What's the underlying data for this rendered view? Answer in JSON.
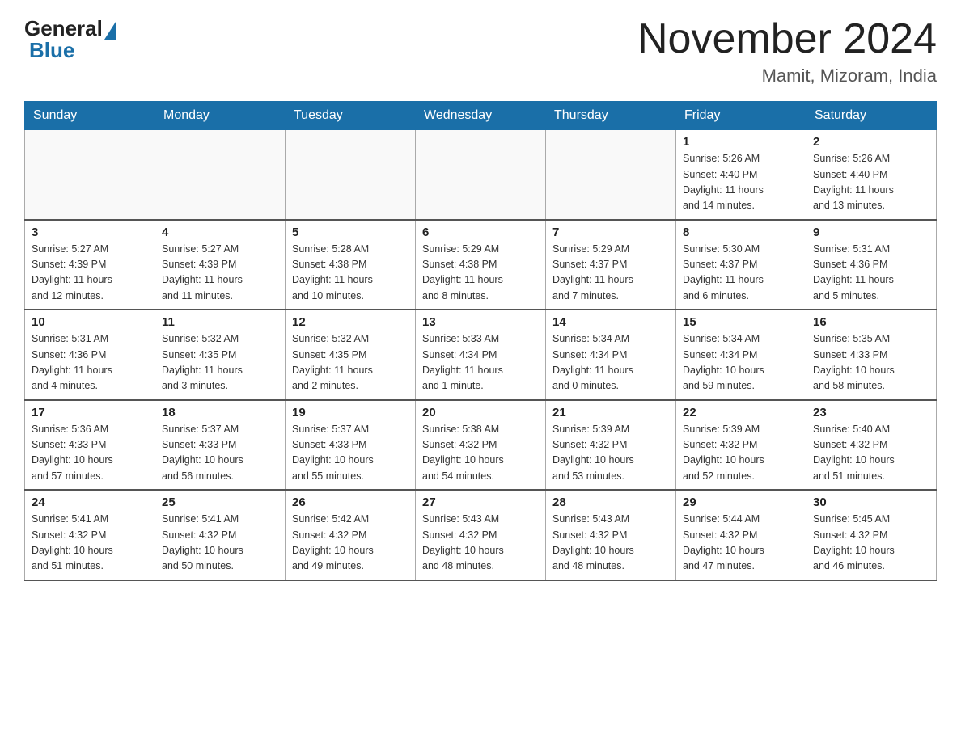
{
  "logo": {
    "general": "General",
    "blue": "Blue"
  },
  "header": {
    "month": "November 2024",
    "location": "Mamit, Mizoram, India"
  },
  "weekdays": [
    "Sunday",
    "Monday",
    "Tuesday",
    "Wednesday",
    "Thursday",
    "Friday",
    "Saturday"
  ],
  "weeks": [
    [
      {
        "day": "",
        "info": ""
      },
      {
        "day": "",
        "info": ""
      },
      {
        "day": "",
        "info": ""
      },
      {
        "day": "",
        "info": ""
      },
      {
        "day": "",
        "info": ""
      },
      {
        "day": "1",
        "info": "Sunrise: 5:26 AM\nSunset: 4:40 PM\nDaylight: 11 hours\nand 14 minutes."
      },
      {
        "day": "2",
        "info": "Sunrise: 5:26 AM\nSunset: 4:40 PM\nDaylight: 11 hours\nand 13 minutes."
      }
    ],
    [
      {
        "day": "3",
        "info": "Sunrise: 5:27 AM\nSunset: 4:39 PM\nDaylight: 11 hours\nand 12 minutes."
      },
      {
        "day": "4",
        "info": "Sunrise: 5:27 AM\nSunset: 4:39 PM\nDaylight: 11 hours\nand 11 minutes."
      },
      {
        "day": "5",
        "info": "Sunrise: 5:28 AM\nSunset: 4:38 PM\nDaylight: 11 hours\nand 10 minutes."
      },
      {
        "day": "6",
        "info": "Sunrise: 5:29 AM\nSunset: 4:38 PM\nDaylight: 11 hours\nand 8 minutes."
      },
      {
        "day": "7",
        "info": "Sunrise: 5:29 AM\nSunset: 4:37 PM\nDaylight: 11 hours\nand 7 minutes."
      },
      {
        "day": "8",
        "info": "Sunrise: 5:30 AM\nSunset: 4:37 PM\nDaylight: 11 hours\nand 6 minutes."
      },
      {
        "day": "9",
        "info": "Sunrise: 5:31 AM\nSunset: 4:36 PM\nDaylight: 11 hours\nand 5 minutes."
      }
    ],
    [
      {
        "day": "10",
        "info": "Sunrise: 5:31 AM\nSunset: 4:36 PM\nDaylight: 11 hours\nand 4 minutes."
      },
      {
        "day": "11",
        "info": "Sunrise: 5:32 AM\nSunset: 4:35 PM\nDaylight: 11 hours\nand 3 minutes."
      },
      {
        "day": "12",
        "info": "Sunrise: 5:32 AM\nSunset: 4:35 PM\nDaylight: 11 hours\nand 2 minutes."
      },
      {
        "day": "13",
        "info": "Sunrise: 5:33 AM\nSunset: 4:34 PM\nDaylight: 11 hours\nand 1 minute."
      },
      {
        "day": "14",
        "info": "Sunrise: 5:34 AM\nSunset: 4:34 PM\nDaylight: 11 hours\nand 0 minutes."
      },
      {
        "day": "15",
        "info": "Sunrise: 5:34 AM\nSunset: 4:34 PM\nDaylight: 10 hours\nand 59 minutes."
      },
      {
        "day": "16",
        "info": "Sunrise: 5:35 AM\nSunset: 4:33 PM\nDaylight: 10 hours\nand 58 minutes."
      }
    ],
    [
      {
        "day": "17",
        "info": "Sunrise: 5:36 AM\nSunset: 4:33 PM\nDaylight: 10 hours\nand 57 minutes."
      },
      {
        "day": "18",
        "info": "Sunrise: 5:37 AM\nSunset: 4:33 PM\nDaylight: 10 hours\nand 56 minutes."
      },
      {
        "day": "19",
        "info": "Sunrise: 5:37 AM\nSunset: 4:33 PM\nDaylight: 10 hours\nand 55 minutes."
      },
      {
        "day": "20",
        "info": "Sunrise: 5:38 AM\nSunset: 4:32 PM\nDaylight: 10 hours\nand 54 minutes."
      },
      {
        "day": "21",
        "info": "Sunrise: 5:39 AM\nSunset: 4:32 PM\nDaylight: 10 hours\nand 53 minutes."
      },
      {
        "day": "22",
        "info": "Sunrise: 5:39 AM\nSunset: 4:32 PM\nDaylight: 10 hours\nand 52 minutes."
      },
      {
        "day": "23",
        "info": "Sunrise: 5:40 AM\nSunset: 4:32 PM\nDaylight: 10 hours\nand 51 minutes."
      }
    ],
    [
      {
        "day": "24",
        "info": "Sunrise: 5:41 AM\nSunset: 4:32 PM\nDaylight: 10 hours\nand 51 minutes."
      },
      {
        "day": "25",
        "info": "Sunrise: 5:41 AM\nSunset: 4:32 PM\nDaylight: 10 hours\nand 50 minutes."
      },
      {
        "day": "26",
        "info": "Sunrise: 5:42 AM\nSunset: 4:32 PM\nDaylight: 10 hours\nand 49 minutes."
      },
      {
        "day": "27",
        "info": "Sunrise: 5:43 AM\nSunset: 4:32 PM\nDaylight: 10 hours\nand 48 minutes."
      },
      {
        "day": "28",
        "info": "Sunrise: 5:43 AM\nSunset: 4:32 PM\nDaylight: 10 hours\nand 48 minutes."
      },
      {
        "day": "29",
        "info": "Sunrise: 5:44 AM\nSunset: 4:32 PM\nDaylight: 10 hours\nand 47 minutes."
      },
      {
        "day": "30",
        "info": "Sunrise: 5:45 AM\nSunset: 4:32 PM\nDaylight: 10 hours\nand 46 minutes."
      }
    ]
  ]
}
